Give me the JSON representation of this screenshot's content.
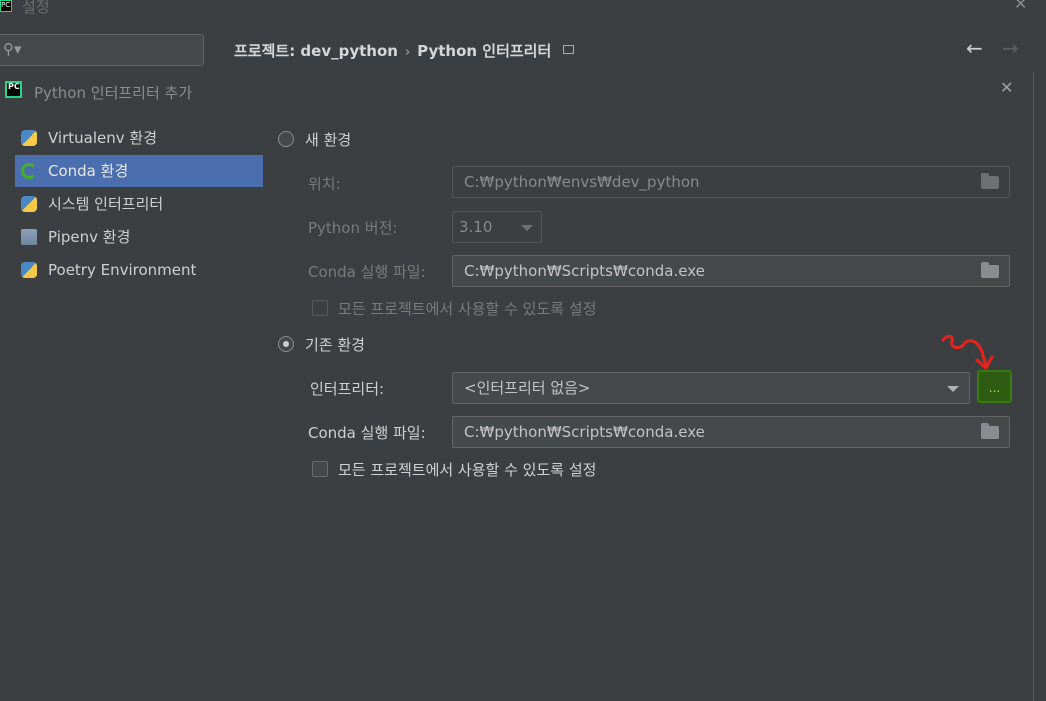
{
  "window": {
    "title": "설정",
    "breadcrumb": [
      "프로젝트: dev_python",
      "Python 인터프리터"
    ]
  },
  "dialog": {
    "title": "Python 인터프리터 추가",
    "env_types": [
      {
        "label": "Virtualenv 환경",
        "icon": "python-icon"
      },
      {
        "label": "Conda 환경",
        "icon": "conda-icon",
        "selected": true
      },
      {
        "label": "시스템 인터프리터",
        "icon": "python-icon"
      },
      {
        "label": "Pipenv 환경",
        "icon": "pipenv-icon"
      },
      {
        "label": "Poetry Environment",
        "icon": "python-icon"
      }
    ],
    "new_env": {
      "radio_label": "새 환경",
      "location_label": "위치:",
      "location_value": "C:₩python₩envs₩dev_python",
      "python_version_label": "Python 버전:",
      "python_version_value": "3.10",
      "conda_exe_label": "Conda 실행 파일:",
      "conda_exe_value": "C:₩python₩Scripts₩conda.exe",
      "share_label": "모든 프로젝트에서 사용할 수 있도록 설정"
    },
    "existing_env": {
      "radio_label": "기존 환경",
      "interpreter_label": "인터프리터:",
      "interpreter_value": "<인터프리터 없음>",
      "browse_label": "...",
      "conda_exe_label": "Conda 실행 파일:",
      "conda_exe_value": "C:₩python₩Scripts₩conda.exe",
      "share_label": "모든 프로젝트에서 사용할 수 있도록 설정"
    }
  },
  "colors": {
    "background": "#3c3f41",
    "selection": "#4b6eaf",
    "browse_highlight": "#2e5c12",
    "annotation": "#e8231c"
  }
}
